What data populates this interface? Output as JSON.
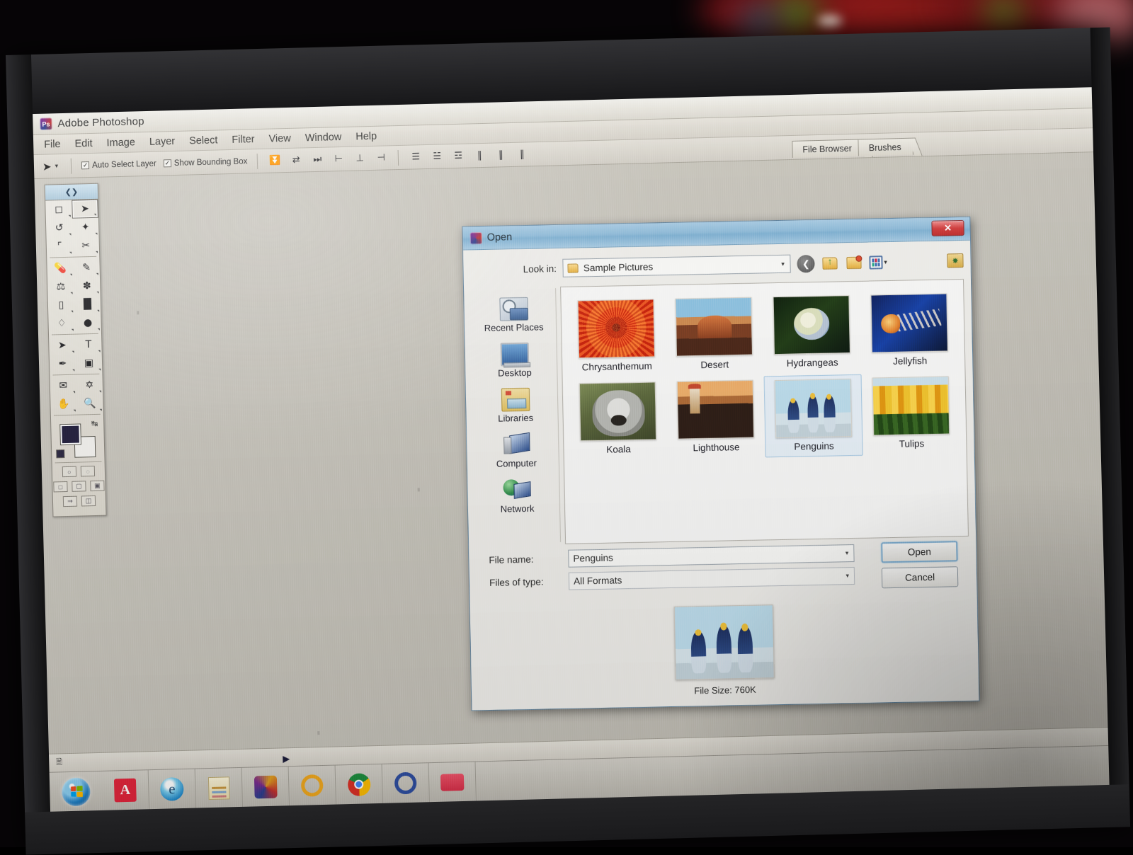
{
  "app": {
    "title": "Adobe Photoshop",
    "icon": "photoshop-icon",
    "menus": [
      "File",
      "Edit",
      "Image",
      "Layer",
      "Select",
      "Filter",
      "View",
      "Window",
      "Help"
    ],
    "options_bar": {
      "tool_icon": "move-tool-icon",
      "checkboxes": [
        {
          "label": "Auto Select Layer",
          "checked": true
        },
        {
          "label": "Show Bounding Box",
          "checked": true
        }
      ],
      "align_buttons": [
        "align-top-edges",
        "align-vertical-centers",
        "align-bottom-edges",
        "align-left-edges",
        "align-horizontal-centers",
        "align-right-edges"
      ],
      "distribute_buttons": [
        "distribute-top-edges",
        "distribute-vertical-centers",
        "distribute-bottom-edges",
        "distribute-left-edges",
        "distribute-horizontal-centers",
        "distribute-right-edges"
      ]
    },
    "palette_tabs": [
      "File Browser",
      "Brushes"
    ],
    "toolbox": {
      "tools_row1": [
        "rectangular-marquee-icon",
        "move-tool-icon"
      ],
      "tools_row2": [
        "lasso-icon",
        "magic-wand-icon"
      ],
      "tools_row3": [
        "crop-icon",
        "slice-icon"
      ],
      "tools_row4": [
        "healing-brush-icon",
        "brush-icon"
      ],
      "tools_row5": [
        "clone-stamp-icon",
        "history-brush-icon"
      ],
      "tools_row6": [
        "eraser-icon",
        "gradient-icon"
      ],
      "tools_row7": [
        "blur-icon",
        "dodge-icon"
      ],
      "tools_row8": [
        "path-selection-icon",
        "type-tool-icon"
      ],
      "tools_row9": [
        "pen-icon",
        "shape-icon"
      ],
      "tools_row10": [
        "notes-icon",
        "eyedropper-icon"
      ],
      "tools_row11": [
        "hand-tool-icon",
        "zoom-tool-icon"
      ],
      "foreground_color": "#221f3d",
      "background_color": "#f6f5f1"
    },
    "status_bar_icon": "doc-info-icon"
  },
  "dialog": {
    "title": "Open",
    "icon": "photoshop-icon",
    "close_label": "✕",
    "lookin": {
      "label": "Look in:",
      "value": "Sample Pictures",
      "icon": "folder-icon",
      "caret": "▾"
    },
    "nav_buttons": [
      {
        "name": "back-button",
        "glyph": "←"
      },
      {
        "name": "up-one-level-button",
        "glyph": "↑"
      },
      {
        "name": "new-folder-button",
        "glyph": ""
      },
      {
        "name": "views-button",
        "glyph": "▾"
      },
      {
        "name": "tools-button",
        "glyph": "✸"
      }
    ],
    "places": [
      {
        "label": "Recent Places",
        "icon": "recent-places-icon",
        "css": "ico-recent"
      },
      {
        "label": "Desktop",
        "icon": "desktop-icon",
        "css": "ico-desktop"
      },
      {
        "label": "Libraries",
        "icon": "libraries-icon",
        "css": "ico-lib"
      },
      {
        "label": "Computer",
        "icon": "computer-icon",
        "css": "ico-computer"
      },
      {
        "label": "Network",
        "icon": "network-icon",
        "css": "ico-network"
      }
    ],
    "files": [
      {
        "label": "Chrysanthemum",
        "thumb": "th-chrys",
        "selected": false
      },
      {
        "label": "Desert",
        "thumb": "th-desert",
        "selected": false
      },
      {
        "label": "Hydrangeas",
        "thumb": "th-hydr",
        "selected": false
      },
      {
        "label": "Jellyfish",
        "thumb": "th-jelly",
        "selected": false
      },
      {
        "label": "Koala",
        "thumb": "th-koala",
        "selected": false
      },
      {
        "label": "Lighthouse",
        "thumb": "th-light",
        "selected": false
      },
      {
        "label": "Penguins",
        "thumb": "th-peng",
        "selected": true
      },
      {
        "label": "Tulips",
        "thumb": "th-tulip",
        "selected": false
      }
    ],
    "filename": {
      "label": "File name:",
      "value": "Penguins",
      "caret": "▾"
    },
    "filetype": {
      "label": "Files of type:",
      "value": "All Formats",
      "caret": "▾"
    },
    "buttons": {
      "open": "Open",
      "cancel": "Cancel"
    },
    "preview": {
      "thumb": "th-peng",
      "size_text": "File Size:  760K"
    }
  },
  "taskbar": {
    "start": "start-orb-icon",
    "items": [
      "adobe-reader-icon",
      "internet-explorer-icon",
      "sticky-notes-icon",
      "photoshop-icon",
      "ring-app-icon",
      "chrome-icon",
      "opera-icon",
      "red-app-icon"
    ],
    "overflow_arrow": "▶"
  },
  "colors": {
    "dialog_titlebar": "#8fbcda",
    "close_button": "#d33b3b",
    "selection": "#eaf3fb",
    "desktop": "#c3c0b8"
  }
}
